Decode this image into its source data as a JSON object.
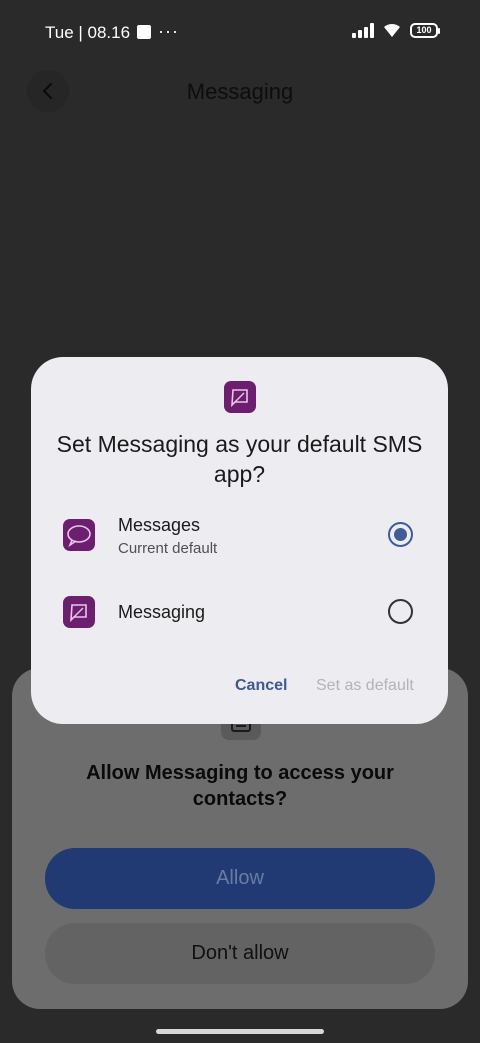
{
  "status_bar": {
    "time": "Tue | 08.16",
    "more": "···",
    "battery": "100"
  },
  "app_bar": {
    "title": "Messaging"
  },
  "permission_sheet": {
    "question": "Allow Messaging to access your contacts?",
    "allow_label": "Allow",
    "deny_label": "Don't allow"
  },
  "dialog": {
    "title": "Set Messaging as your default SMS app?",
    "options": [
      {
        "name": "Messages",
        "subtitle": "Current default",
        "selected": true
      },
      {
        "name": "Messaging",
        "subtitle": "",
        "selected": false
      }
    ],
    "cancel_label": "Cancel",
    "confirm_label": "Set as default"
  },
  "colors": {
    "accent": "#3f5c95",
    "dialog_bg": "#edecf1",
    "app_icon": "#6b1f6e"
  }
}
